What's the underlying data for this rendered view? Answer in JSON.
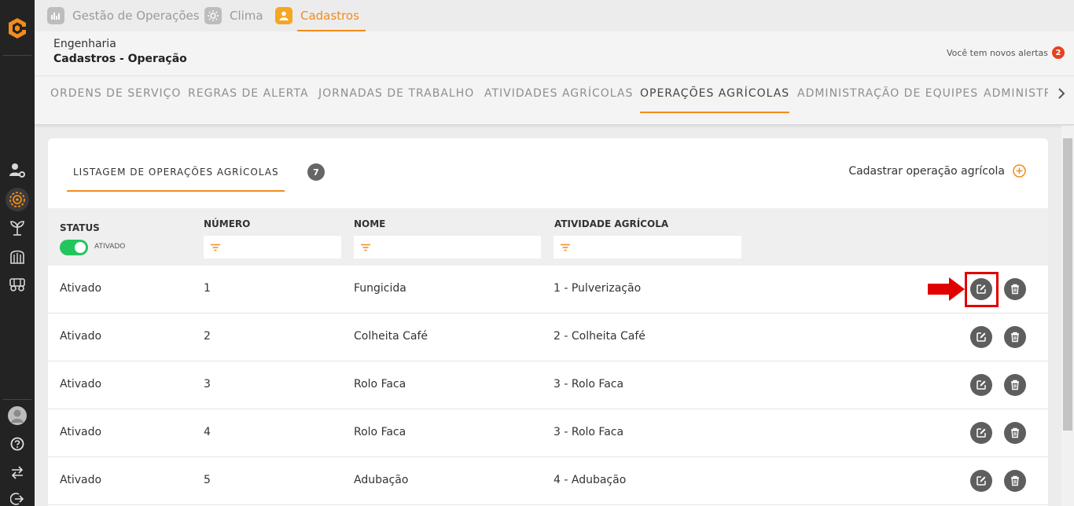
{
  "modules": [
    {
      "label": "Gestão de Operações",
      "icon": "chart-icon"
    },
    {
      "label": "Clima",
      "icon": "sun-icon"
    },
    {
      "label": "Cadastros",
      "icon": "user-icon",
      "active": true
    }
  ],
  "header": {
    "breadcrumb_parent": "Engenharia",
    "breadcrumb_current": "Cadastros - Operação",
    "alerts_text": "Você tem novos alertas",
    "alerts_count": "2"
  },
  "tabs": [
    {
      "label": "ORDENS DE SERVIÇO"
    },
    {
      "label": "REGRAS DE ALERTA"
    },
    {
      "label": "JORNADAS DE TRABALHO"
    },
    {
      "label": "ATIVIDADES AGRÍCOLAS"
    },
    {
      "label": "OPERAÇÕES AGRÍCOLAS",
      "active": true
    },
    {
      "label": "ADMINISTRAÇÃO DE EQUIPES"
    },
    {
      "label": "ADMINISTR"
    }
  ],
  "listing": {
    "title": "LISTAGEM DE OPERAÇÕES AGRÍCOLAS",
    "count": "7",
    "create_label": "Cadastrar operação agrícola"
  },
  "columns": {
    "status": "STATUS",
    "status_toggle_label": "ATIVADO",
    "numero": "NÚMERO",
    "nome": "NOME",
    "atividade": "ATIVIDADE AGRÍCOLA"
  },
  "rows": [
    {
      "status": "Ativado",
      "numero": "1",
      "nome": "Fungicida",
      "atividade": "1 - Pulverização"
    },
    {
      "status": "Ativado",
      "numero": "2",
      "nome": "Colheita Café",
      "atividade": "2 - Colheita Café"
    },
    {
      "status": "Ativado",
      "numero": "3",
      "nome": "Rolo Faca",
      "atividade": "3 - Rolo Faca"
    },
    {
      "status": "Ativado",
      "numero": "4",
      "nome": "Rolo Faca",
      "atividade": "3 - Rolo Faca"
    },
    {
      "status": "Ativado",
      "numero": "5",
      "nome": "Adubação",
      "atividade": "4 - Adubação"
    }
  ],
  "colors": {
    "accent": "#f28c1c",
    "rail": "#232323",
    "toggle_on": "#22c55e",
    "alert_badge": "#e8411f",
    "annotation": "#e00000"
  }
}
